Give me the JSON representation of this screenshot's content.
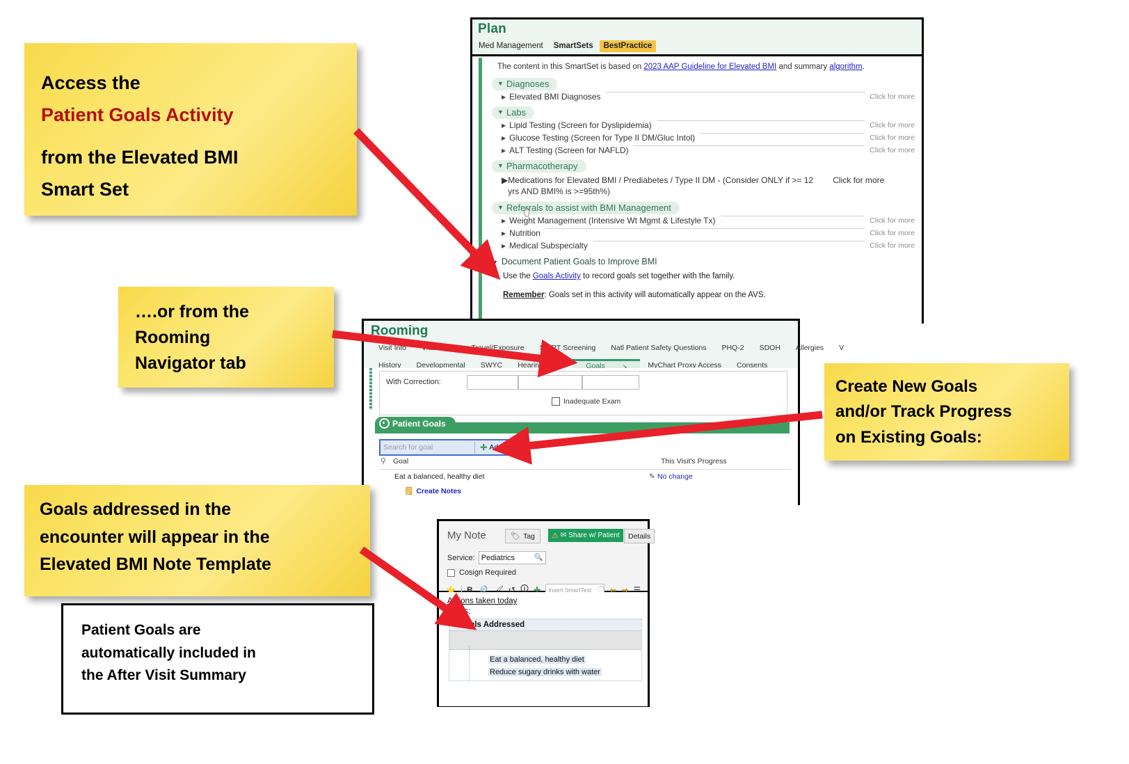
{
  "notes": [
    {
      "id": "note-smartset",
      "lines": [
        {
          "text": "Access the",
          "color": "black"
        },
        {
          "text": "Patient Goals Activity",
          "color": "red"
        },
        {
          "text": "",
          "color": "black"
        },
        {
          "text": "from the Elevated BMI",
          "color": "black"
        },
        {
          "text": "Smart Set",
          "color": "black"
        }
      ]
    },
    {
      "id": "note-rooming",
      "lines": [
        {
          "text": "….or from the",
          "color": "black"
        },
        {
          "text": "Rooming",
          "color": "black"
        },
        {
          "text": "Navigator tab",
          "color": "black"
        }
      ]
    },
    {
      "id": "note-creategoals",
      "lines": [
        {
          "text": "Create New Goals",
          "color": "black"
        },
        {
          "text": "and/or Track Progress",
          "color": "black"
        },
        {
          "text": "on Existing Goals:",
          "color": "black"
        }
      ]
    },
    {
      "id": "note-notetemplate",
      "lines": [
        {
          "text": "Goals addressed in the",
          "color": "black"
        },
        {
          "text": "encounter will appear in the",
          "color": "black"
        },
        {
          "text": "Elevated BMI Note Template",
          "color": "black"
        }
      ]
    }
  ],
  "avs_box": {
    "lines": [
      "Patient Goals are",
      "automatically included in",
      "the After Visit Summary"
    ]
  },
  "plan": {
    "title": "Plan",
    "tabs": [
      {
        "label": "Med Management",
        "active": false,
        "bold": false
      },
      {
        "label": "SmartSets",
        "active": false,
        "bold": true
      },
      {
        "label": "BestPractice",
        "active": true,
        "bold": true
      }
    ],
    "intro": {
      "pre": "The content in this SmartSet is based on ",
      "link1": "2023 AAP Guideline for Elevated BMI",
      "mid": " and summary ",
      "link2": "algorithm",
      "post": "."
    },
    "click_for_more": "Click for more",
    "sections": [
      {
        "heading": "Diagnoses",
        "rows": [
          {
            "label": "Elevated BMI Diagnoses",
            "more": true
          }
        ]
      },
      {
        "heading": "Labs",
        "rows": [
          {
            "label": "Lipid Testing (Screen for Dyslipidemia)",
            "more": true
          },
          {
            "label": "Glucose Testing (Screen for Type II DM/Gluc Intol)",
            "more": true
          },
          {
            "label": "ALT Testing (Screen for NAFLD)",
            "more": true
          }
        ]
      },
      {
        "heading": "Pharmacotherapy",
        "rows": [
          {
            "label": "Medications for Elevated BMI / Prediabetes / Type II DM - (Consider ONLY if >= 12 yrs AND BMI% is >=95th%)",
            "more": true,
            "wrap": true
          }
        ]
      },
      {
        "heading": "Referrals to assist with BMI Management",
        "rows": [
          {
            "label": "Weight Management (Intensive Wt Mgmt & Lifestyle Tx)",
            "more": true
          },
          {
            "label": "Nutrition",
            "more": true
          },
          {
            "label": "Medical Subspecialty",
            "more": true
          }
        ]
      }
    ],
    "goals_section": {
      "heading": "Document Patient Goals to Improve BMI",
      "line1_pre": "Use the ",
      "line1_link": "Goals Activity",
      "line1_post": " to record goals set together with the family.",
      "line2_bold": "Remember",
      "line2_rest": ": Goals set in this activity will automatically appear on the AVS."
    }
  },
  "rooming": {
    "title": "Rooming",
    "tabs_row1": [
      "Visit Info",
      "Vital Signs",
      "Travel/Exposure",
      "SBIRT Screening",
      "Natl Patient Safety Questions",
      "PHQ-2",
      "SDOH",
      "Allergies",
      "V"
    ],
    "tabs_row2": [
      "History",
      "Developmental",
      "SWYC",
      "Hearing/Vision",
      "Goals",
      "MyChart Proxy Access",
      "Consents"
    ],
    "active_tab": "Goals",
    "vision": {
      "label": "With Correction:",
      "inadequate_label": "Inadequate Exam"
    },
    "patient_goals": {
      "section_title": "Patient Goals",
      "search_placeholder": "Search for goal",
      "add_label": "Add",
      "col_goal": "Goal",
      "col_progress": "This Visit's Progress",
      "rows": [
        {
          "goal": "Eat a balanced, healthy diet",
          "progress": "No change"
        }
      ],
      "create_notes_label": "Create Notes"
    }
  },
  "mynote": {
    "title": "My Note",
    "tag_label": "Tag",
    "share_label": "Share w/ Patient",
    "details_label": "Details",
    "service_label": "Service:",
    "service_value": "Pediatrics",
    "cosign_label": "Cosign Required",
    "smarttext_placeholder": "Insert SmartText",
    "body": {
      "actions_heading": "Actions taken today",
      "goals_label": "Goals:",
      "table_heading": "Goals Addressed",
      "bullets": [
        "Eat a balanced, healthy diet",
        "Reduce sugary drinks with water"
      ]
    }
  },
  "colors": {
    "sticky_yellow": "#fbe468",
    "accent_red": "#b31010",
    "epic_green": "#1e7a52",
    "arrow_red": "#e8202a",
    "tab_gold": "#f5c342",
    "link_blue": "#2222cc"
  }
}
